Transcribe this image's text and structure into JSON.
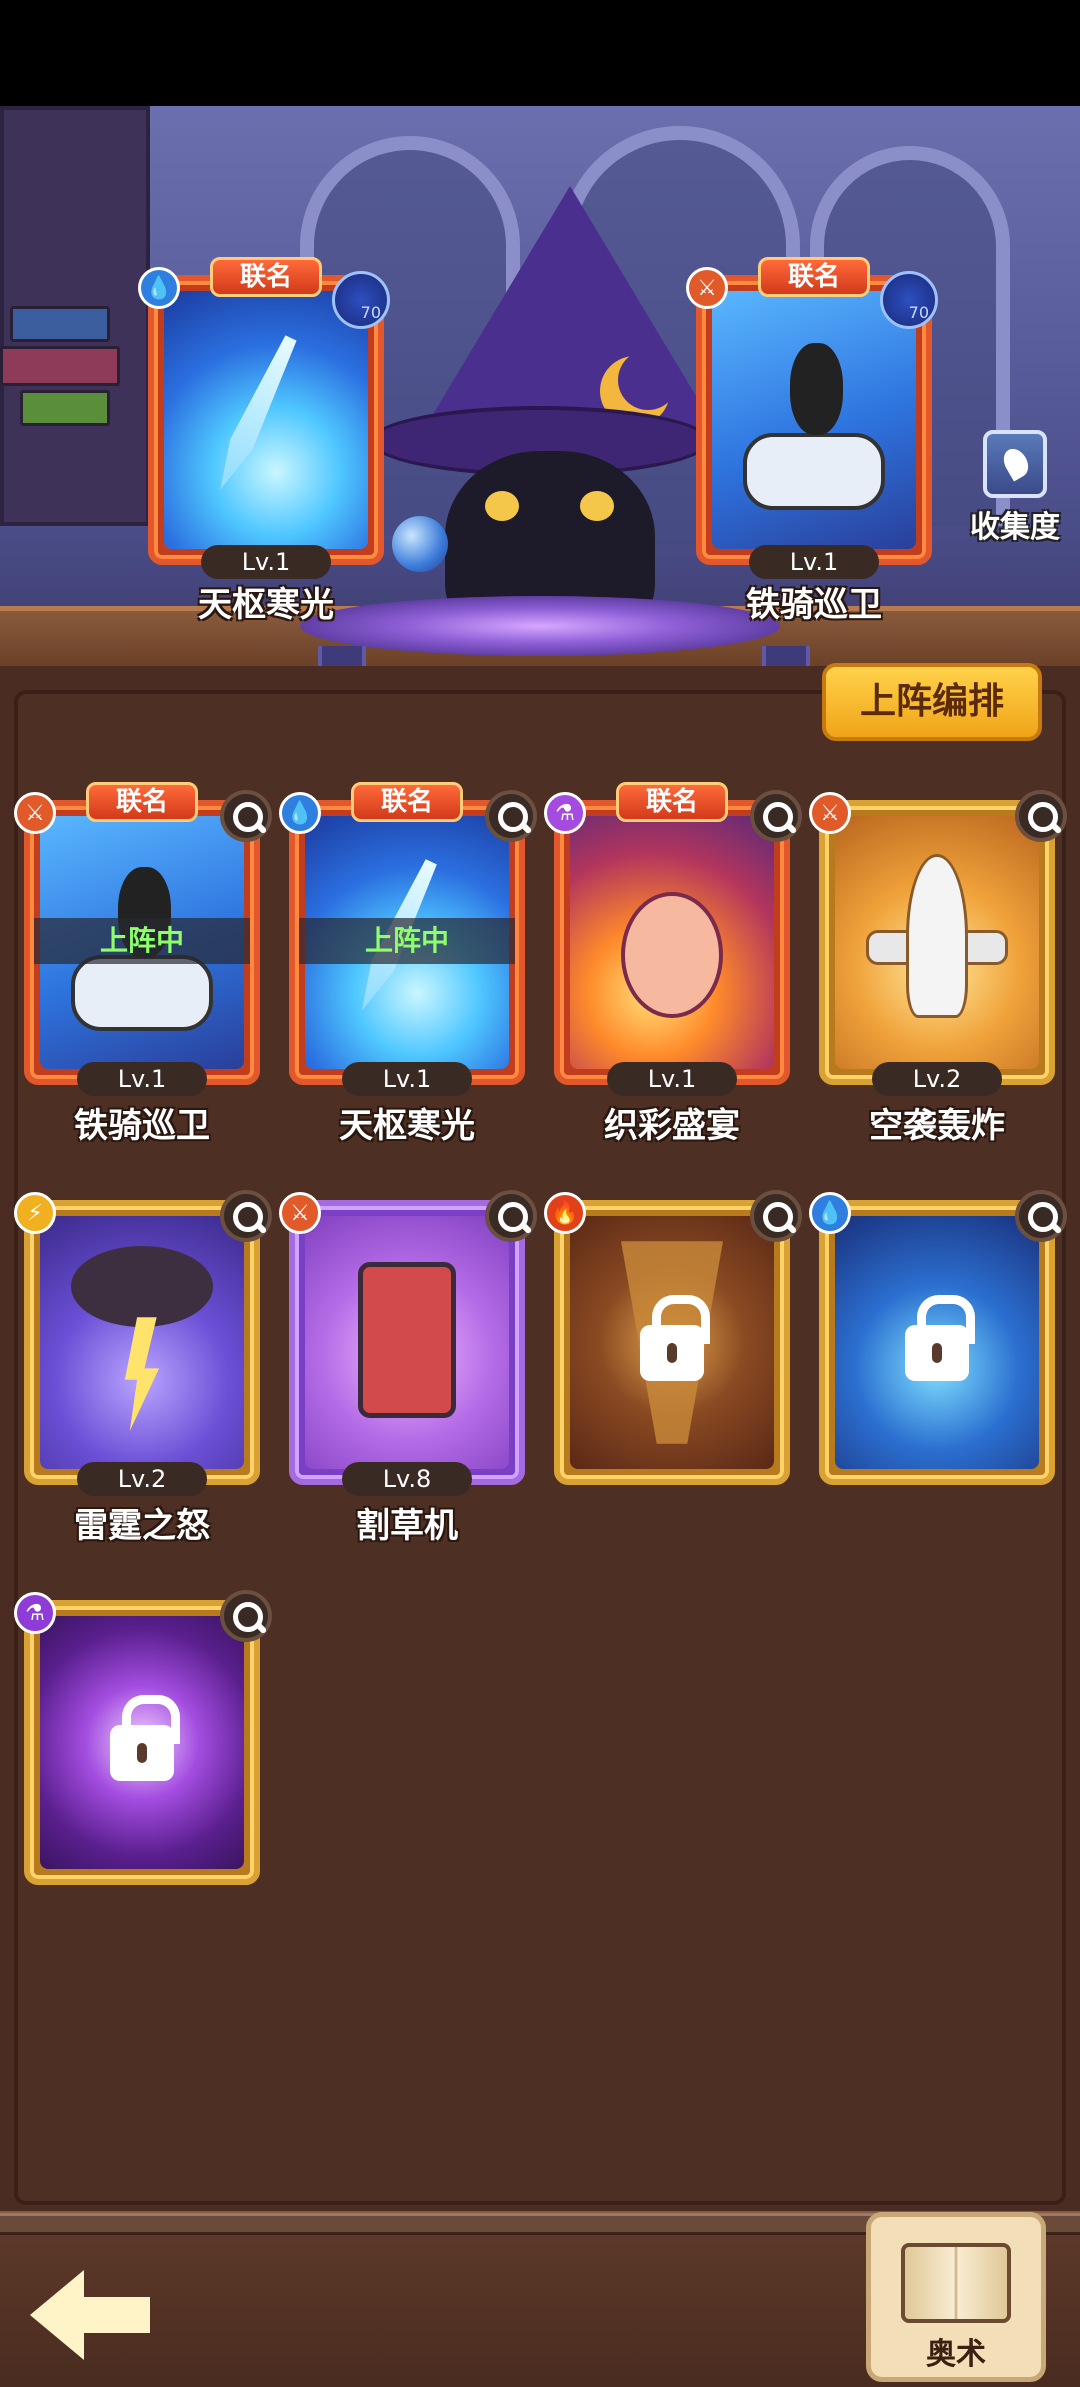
{
  "scene": {
    "collection_label": "收集度",
    "deploy_button": "上阵编排",
    "deployed_cards": [
      {
        "tag": "联名",
        "level": "Lv.1",
        "name": "天枢寒光",
        "element": "water",
        "stat": "70"
      },
      {
        "tag": "联名",
        "level": "Lv.1",
        "name": "铁骑巡卫",
        "element": "sword",
        "stat": "70"
      }
    ]
  },
  "cards": [
    {
      "tag": "联名",
      "level": "Lv.1",
      "name": "铁骑巡卫",
      "status": "上阵中",
      "element": "sword",
      "rarity": "orange",
      "art": "motorcycle"
    },
    {
      "tag": "联名",
      "level": "Lv.1",
      "name": "天枢寒光",
      "status": "上阵中",
      "element": "water",
      "rarity": "orange",
      "art": "ice-sword"
    },
    {
      "tag": "联名",
      "level": "Lv.1",
      "name": "织彩盛宴",
      "status": "",
      "element": "potion",
      "rarity": "orange",
      "art": "party"
    },
    {
      "tag": "",
      "level": "Lv.2",
      "name": "空袭轰炸",
      "status": "",
      "element": "sword",
      "rarity": "gold",
      "art": "airplane"
    },
    {
      "tag": "",
      "level": "Lv.2",
      "name": "雷霆之怒",
      "status": "",
      "element": "bolt",
      "rarity": "gold",
      "art": "storm"
    },
    {
      "tag": "",
      "level": "Lv.8",
      "name": "割草机",
      "status": "",
      "element": "sword",
      "rarity": "purple",
      "art": "mower"
    },
    {
      "tag": "",
      "level": "",
      "name": "",
      "status": "locked",
      "element": "fire",
      "rarity": "gold",
      "art": "tornado"
    },
    {
      "tag": "",
      "level": "",
      "name": "",
      "status": "locked",
      "element": "water",
      "rarity": "gold",
      "art": "crystal"
    },
    {
      "tag": "",
      "level": "",
      "name": "",
      "status": "locked",
      "element": "potion",
      "rarity": "gold",
      "art": "void"
    }
  ],
  "bottom": {
    "arcana_label": "奥术"
  }
}
